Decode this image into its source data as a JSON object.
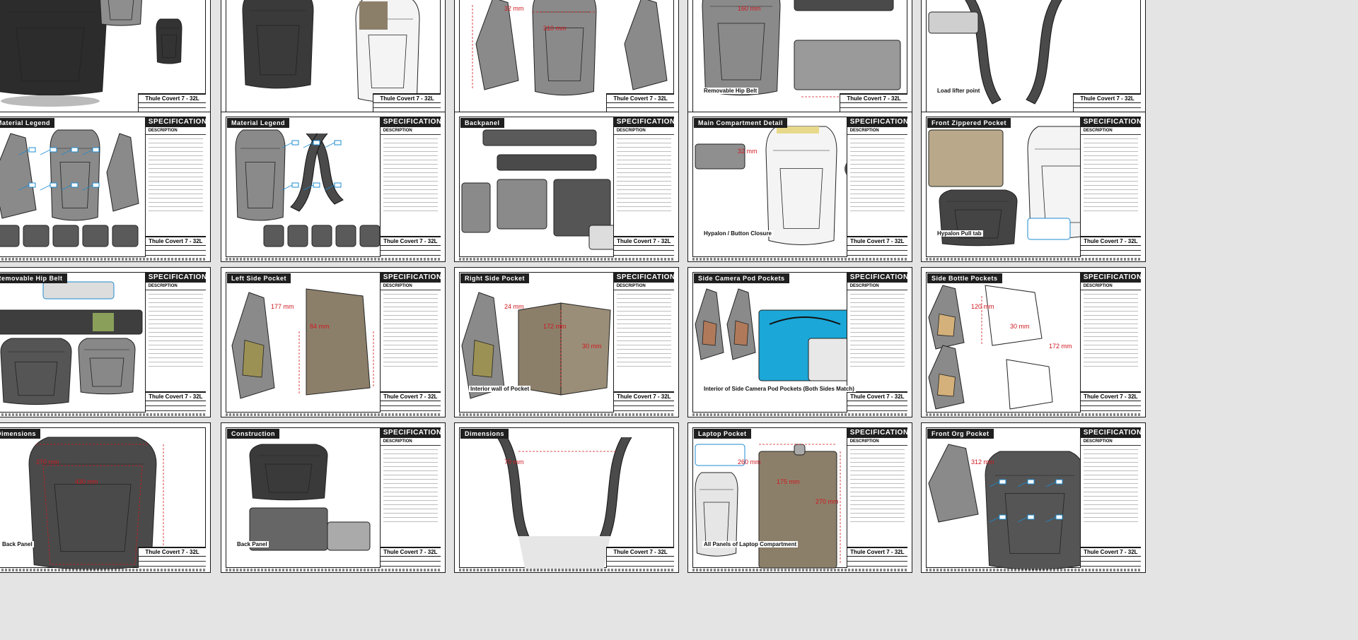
{
  "colors": {
    "background": "#e4e4e4",
    "sheet": "#ffffff",
    "ink": "#1f1f1f",
    "dimension_red": "#d0181f",
    "callout_blue": "#1c8bd0",
    "bag_gray": "#8a8a8a",
    "bag_dark": "#4a4a4a",
    "fabric_tan": "#8c7f6a",
    "liner_blue": "#1ba7d8",
    "hip_green": "#8aa05a"
  },
  "common": {
    "spec_title": "SPECIFICATIONS:",
    "description_label": "DESCRIPTION",
    "product_name": "Thule Covert 7 - 32L"
  },
  "sheets": [
    {
      "id": "r1c1",
      "header": "",
      "has_spec": false,
      "art": "bag-hero-dark",
      "labels": [],
      "dims": []
    },
    {
      "id": "r1c2",
      "header": "",
      "has_spec": false,
      "art": "bag-hero-sketch",
      "labels": [],
      "dims": []
    },
    {
      "id": "r1c3",
      "header": "",
      "has_spec": false,
      "art": "bag-views-dims",
      "labels": [],
      "dims": [
        "32 mm",
        "310 mm"
      ]
    },
    {
      "id": "r1c4",
      "header": "",
      "has_spec": false,
      "art": "backpanel-hipbelt",
      "labels": [
        "Removable Hip Belt"
      ],
      "dims": [
        "160 mm"
      ]
    },
    {
      "id": "r1c5",
      "header": "",
      "has_spec": false,
      "art": "straps",
      "labels": [
        "Load lifter point"
      ],
      "dims": []
    },
    {
      "id": "r2c1",
      "header": "Material Legend",
      "has_spec": true,
      "art": "bag-views-legend",
      "labels": [],
      "dims": []
    },
    {
      "id": "r2c2",
      "header": "Material Legend",
      "has_spec": true,
      "art": "bag-parts-legend",
      "labels": [],
      "dims": []
    },
    {
      "id": "r2c3",
      "header": "Backpanel",
      "has_spec": true,
      "art": "backpanel-parts",
      "labels": [],
      "dims": []
    },
    {
      "id": "r2c4",
      "header": "Main Compartment Detail",
      "has_spec": true,
      "art": "main-compartment",
      "labels": [
        "Hypalon / Button Closure"
      ],
      "dims": [
        "32 mm"
      ]
    },
    {
      "id": "r2c5",
      "header": "Front Zippered Pocket",
      "has_spec": true,
      "art": "front-pocket",
      "labels": [
        "Hypalon Pull tab"
      ],
      "dims": []
    },
    {
      "id": "r3c1",
      "header": "Removable Hip Belt",
      "has_spec": true,
      "art": "hipbelt",
      "labels": [],
      "dims": []
    },
    {
      "id": "r3c2",
      "header": "Left Side Pocket",
      "has_spec": true,
      "art": "left-pocket",
      "labels": [],
      "dims": [
        "177 mm",
        "84 mm"
      ]
    },
    {
      "id": "r3c3",
      "header": "Right Side Pocket",
      "has_spec": true,
      "art": "right-pocket",
      "labels": [
        "Interior wall of Pocket"
      ],
      "dims": [
        "24 mm",
        "172 mm",
        "30 mm"
      ]
    },
    {
      "id": "r3c4",
      "header": "Side Camera Pod Pockets",
      "has_spec": true,
      "art": "camera-pod",
      "labels": [
        "Interior of Side Camera Pod Pockets (Both Sides Match)"
      ],
      "dims": []
    },
    {
      "id": "r3c5",
      "header": "Side Bottle Pockets",
      "has_spec": true,
      "art": "bottle-pocket",
      "labels": [],
      "dims": [
        "120 mm",
        "30 mm",
        "172 mm"
      ]
    },
    {
      "id": "r4c1",
      "header": "Dimensions",
      "has_spec": false,
      "art": "backpanel-dims",
      "labels": [
        "Back Panel"
      ],
      "dims": [
        "270 mm",
        "430 mm"
      ]
    },
    {
      "id": "r4c2",
      "header": "Construction",
      "has_spec": true,
      "art": "construction",
      "labels": [
        "Back Panel"
      ],
      "dims": []
    },
    {
      "id": "r4c3",
      "header": "Dimensions",
      "has_spec": false,
      "art": "strap-dims",
      "labels": [],
      "dims": [
        "70 mm"
      ]
    },
    {
      "id": "r4c4",
      "header": "Laptop Pocket",
      "has_spec": true,
      "art": "laptop-pocket",
      "labels": [
        "All Panels of Laptop Compartment"
      ],
      "dims": [
        "260 mm",
        "175 mm",
        "270 mm"
      ]
    },
    {
      "id": "r4c5",
      "header": "Front Org Pocket",
      "has_spec": true,
      "art": "front-org",
      "labels": [],
      "dims": [
        "312 mm"
      ]
    }
  ]
}
